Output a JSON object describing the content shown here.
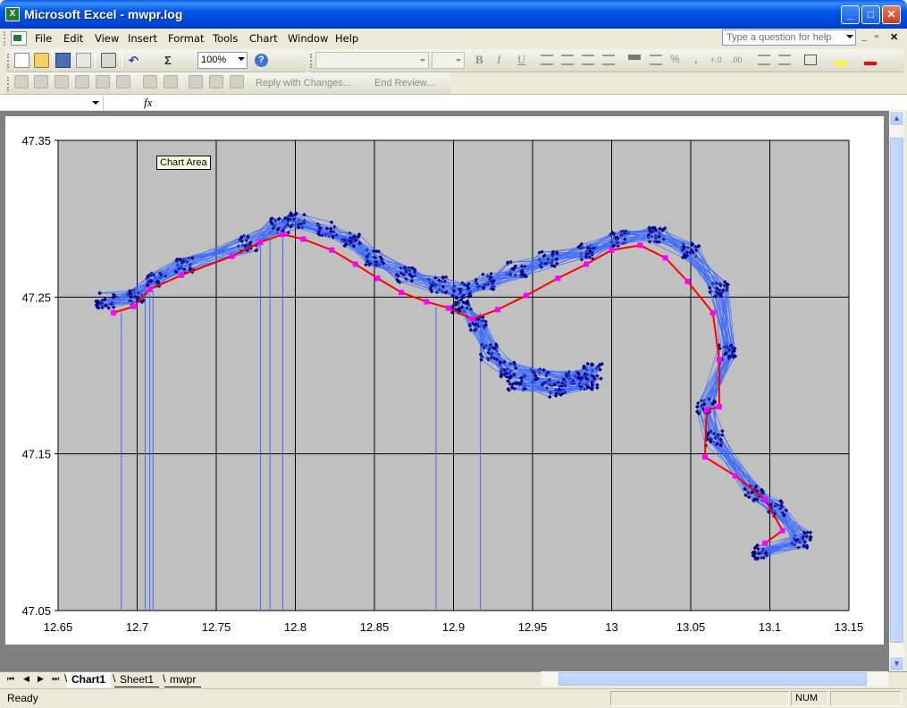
{
  "window": {
    "title": "Microsoft Excel - mwpr.log",
    "app_icon": "excel-icon",
    "minimize_glyph": "_",
    "maximize_glyph": "□",
    "close_glyph": "✕"
  },
  "menubar": {
    "items": [
      "File",
      "Edit",
      "View",
      "Insert",
      "Format",
      "Tools",
      "Chart",
      "Window",
      "Help"
    ],
    "help_placeholder": "Type a question for help",
    "mdi_min": "_",
    "mdi_restore": "▫",
    "mdi_close": "✕"
  },
  "standard_toolbar": {
    "icons": [
      "new-icon",
      "open-icon",
      "save-icon",
      "permission-icon",
      "print-icon",
      "undo-icon",
      "autosum-icon",
      "help-icon"
    ],
    "undo_glyph": "↶",
    "autosum_glyph": "Σ",
    "help_glyph": "?",
    "zoom": "100%"
  },
  "formatting_toolbar": {
    "font_name": "",
    "font_size": "",
    "bold": "B",
    "italic": "I",
    "underline": "U",
    "percent": "%",
    "comma": ",",
    "inc_decimal": "+.0",
    "dec_decimal": ".00"
  },
  "reviewing_toolbar": {
    "reply_label": "Reply with Changes...",
    "end_review_label": "End Review..."
  },
  "formula_bar": {
    "name_box": "",
    "fx": "fx",
    "content": ""
  },
  "tooltip": "Chart Area",
  "chart_data": {
    "type": "scatter",
    "title": "",
    "xlabel": "",
    "ylabel": "",
    "xlim": [
      12.65,
      13.15
    ],
    "ylim": [
      47.05,
      47.35
    ],
    "x_ticks": [
      "12.65",
      "12.7",
      "12.75",
      "12.8",
      "12.85",
      "12.9",
      "12.95",
      "13",
      "13.05",
      "13.1",
      "13.15"
    ],
    "y_ticks": [
      "47.35",
      "47.25",
      "47.15",
      "47.05"
    ],
    "x_tick_values": [
      12.65,
      12.7,
      12.75,
      12.8,
      12.85,
      12.9,
      12.95,
      13.0,
      13.05,
      13.1,
      13.15
    ],
    "y_tick_values": [
      47.35,
      47.25,
      47.15,
      47.05
    ],
    "grid": true,
    "plot_background": "#c0c0c0",
    "legend": "none",
    "colors": {
      "raw_line": "#3d6bff",
      "raw_marker": "#000080",
      "mean_line": "#ff0000",
      "mean_marker": "#ff00ff"
    },
    "series": [
      {
        "role": "mean-track",
        "x": [
          12.685,
          12.698,
          12.708,
          12.728,
          12.76,
          12.778,
          12.792,
          12.805,
          12.823,
          12.838,
          12.852,
          12.867,
          12.883,
          12.897,
          12.912,
          12.928,
          12.946,
          12.966,
          12.984,
          13.0,
          13.018,
          13.034,
          13.048,
          13.064,
          13.068,
          13.068,
          13.06,
          13.059,
          13.078,
          13.097,
          13.108,
          13.097
        ],
        "y": [
          47.24,
          47.244,
          47.255,
          47.264,
          47.276,
          47.285,
          47.29,
          47.287,
          47.28,
          47.271,
          47.262,
          47.253,
          47.247,
          47.243,
          47.236,
          47.242,
          47.251,
          47.262,
          47.271,
          47.28,
          47.283,
          47.275,
          47.26,
          47.24,
          47.21,
          47.18,
          47.178,
          47.148,
          47.136,
          47.121,
          47.101,
          47.093
        ]
      },
      {
        "role": "raw-tracks",
        "x": [
          12.68,
          12.7,
          12.712,
          12.73,
          12.77,
          12.79,
          12.8,
          12.82,
          12.835,
          12.85,
          12.87,
          12.89,
          12.905,
          12.92,
          12.94,
          12.96,
          12.985,
          13.005,
          13.028,
          13.05,
          13.068,
          13.073,
          13.06,
          13.065,
          13.09,
          13.105,
          13.12,
          13.095
        ],
        "y": [
          47.248,
          47.25,
          47.262,
          47.27,
          47.284,
          47.296,
          47.299,
          47.293,
          47.286,
          47.275,
          47.264,
          47.258,
          47.254,
          47.26,
          47.268,
          47.274,
          47.279,
          47.287,
          47.29,
          47.28,
          47.255,
          47.215,
          47.18,
          47.16,
          47.125,
          47.115,
          47.095,
          47.088
        ]
      },
      {
        "role": "side-loop",
        "x": [
          12.905,
          12.915,
          12.923,
          12.935,
          12.955,
          12.975,
          12.988,
          12.985,
          12.965,
          12.94
        ],
        "y": [
          47.245,
          47.233,
          47.215,
          47.204,
          47.199,
          47.198,
          47.203,
          47.196,
          47.191,
          47.195
        ]
      },
      {
        "role": "vertical-drops",
        "x": [
          12.69,
          12.705,
          12.708,
          12.71,
          12.778,
          12.784,
          12.792,
          12.889,
          12.917
        ],
        "y_from": [
          47.24,
          47.25,
          47.252,
          47.254,
          47.283,
          47.287,
          47.29,
          47.244,
          47.24
        ],
        "y_to": [
          47.05,
          47.05,
          47.05,
          47.05,
          47.05,
          47.05,
          47.05,
          47.05,
          47.05
        ]
      }
    ]
  },
  "sheet_tabs": {
    "nav_glyphs": [
      "⏮",
      "◀",
      "▶",
      "⏭"
    ],
    "tabs": [
      "Chart1",
      "Sheet1",
      "mwpr"
    ],
    "active": "Chart1"
  },
  "status": {
    "text": "Ready",
    "num": "NUM"
  }
}
